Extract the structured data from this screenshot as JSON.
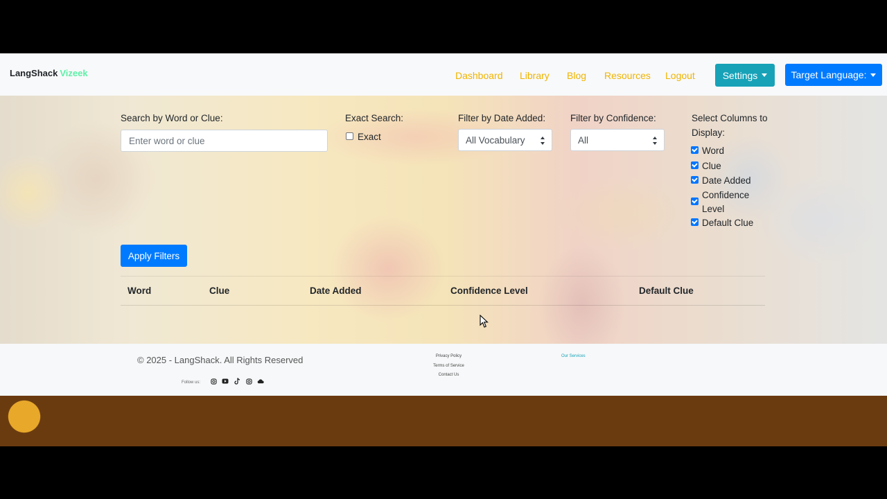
{
  "navbar": {
    "brand": "LangShack",
    "brand_accent": "Vizeek",
    "links": [
      "Dashboard",
      "Library",
      "Blog",
      "Resources",
      "Logout"
    ],
    "settings_label": "Settings",
    "target_language_label": "Target Language:"
  },
  "filters": {
    "search_label": "Search by Word or Clue:",
    "search_placeholder": "Enter word or clue",
    "exact_label": "Exact Search:",
    "exact_checkbox_label": "Exact",
    "date_label": "Filter by Date Added:",
    "date_selected": "All Vocabulary",
    "confidence_label": "Filter by Confidence:",
    "confidence_selected": "All",
    "columns_label_1": "Select Columns to",
    "columns_label_2": "Display:",
    "columns": [
      {
        "label": "Word",
        "checked": true
      },
      {
        "label": "Clue",
        "checked": true
      },
      {
        "label": "Date Added",
        "checked": true
      },
      {
        "label": "Confidence",
        "label2": "Level",
        "checked": true
      },
      {
        "label": "Default Clue",
        "checked": true
      }
    ],
    "apply_label": "Apply Filters"
  },
  "table": {
    "headers": [
      "Word",
      "Clue",
      "Date Added",
      "Confidence Level",
      "Default Clue"
    ]
  },
  "footer": {
    "copyright": "© 2025 - LangShack. All Rights Reserved",
    "follow_label": "Follow us:",
    "links": [
      "Privacy Policy",
      "Terms of Service",
      "Contact Us"
    ],
    "services_link": "Our Services",
    "social_icons": [
      "instagram-icon",
      "youtube-icon",
      "tiktok-icon",
      "instagram-icon",
      "cloud-icon"
    ]
  },
  "colors": {
    "nav_link": "#f0b400",
    "settings_button": "#17a2b8",
    "primary_button": "#007bff",
    "brand_accent": "#5ef0a8"
  }
}
